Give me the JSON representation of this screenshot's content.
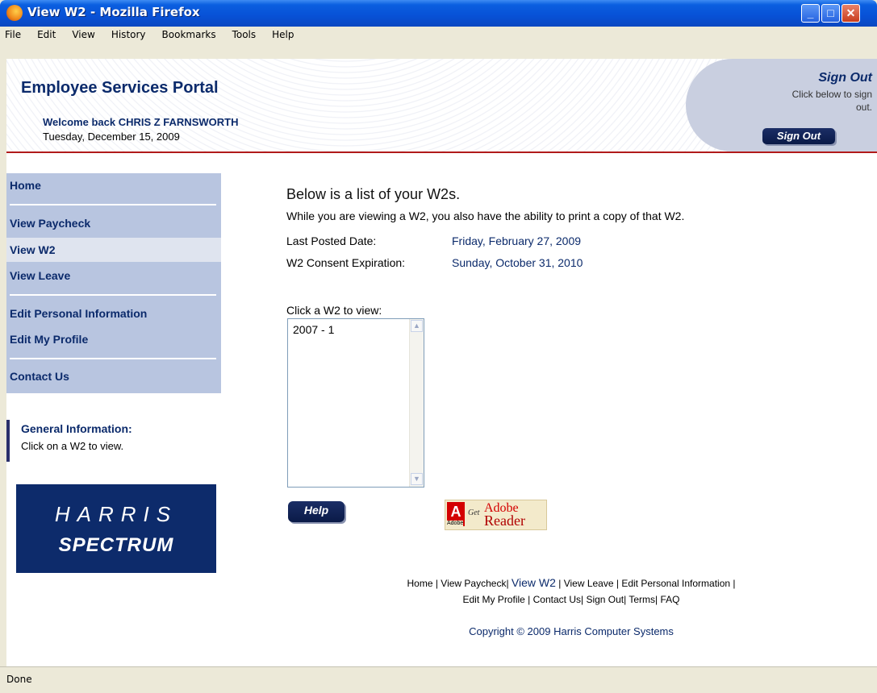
{
  "window": {
    "title": "View W2 - Mozilla Firefox"
  },
  "menubar": {
    "items": [
      "File",
      "Edit",
      "View",
      "History",
      "Bookmarks",
      "Tools",
      "Help"
    ]
  },
  "header": {
    "portal_title": "Employee Services Portal",
    "welcome": "Welcome back CHRIS Z FARNSWORTH",
    "date": "Tuesday, December 15, 2009",
    "signout_title": "Sign Out",
    "signout_text": "Click below to sign out.",
    "signout_button": "Sign Out"
  },
  "sidebar": {
    "items": [
      {
        "label": "Home"
      },
      {
        "label": "View Paycheck"
      },
      {
        "label": "View W2"
      },
      {
        "label": "View Leave"
      },
      {
        "label": "Edit Personal Information"
      },
      {
        "label": "Edit My Profile"
      },
      {
        "label": "Contact Us"
      }
    ],
    "active_item": "View W2",
    "general_info_title": "General Information:",
    "general_info_text": "Click on a W2 to view.",
    "logo_line1": "HARRIS",
    "logo_line2": "SPECTRUM"
  },
  "main": {
    "heading": "Below is a list of your W2s.",
    "description": "While you are viewing a W2, you also have the ability to print a copy of that W2.",
    "last_posted_label": "Last Posted Date:",
    "last_posted_value": "Friday, February 27, 2009",
    "consent_label": "W2 Consent Expiration:",
    "consent_value": "Sunday, October 31, 2010",
    "list_label": "Click a W2 to view:",
    "w2_options": [
      "2007 - 1"
    ],
    "help_button": "Help",
    "adobe_get": "Get",
    "adobe_word": "Adobe",
    "adobe_reader": "Adobe",
    "adobe_reader2": "Reader"
  },
  "footer": {
    "links_line1": [
      "Home",
      "View Paycheck",
      "View W2",
      "View Leave",
      "Edit Personal Information"
    ],
    "links_line2": [
      "Edit My Profile",
      "Contact Us",
      "Sign Out",
      "Terms",
      "FAQ"
    ],
    "copyright": "Copyright © 2009 Harris Computer Systems"
  },
  "statusbar": {
    "text": "Done"
  },
  "colors": {
    "accent": "#0b2a6b",
    "sidebar": "#b8c5e0",
    "header_rule": "#b11a1a"
  }
}
